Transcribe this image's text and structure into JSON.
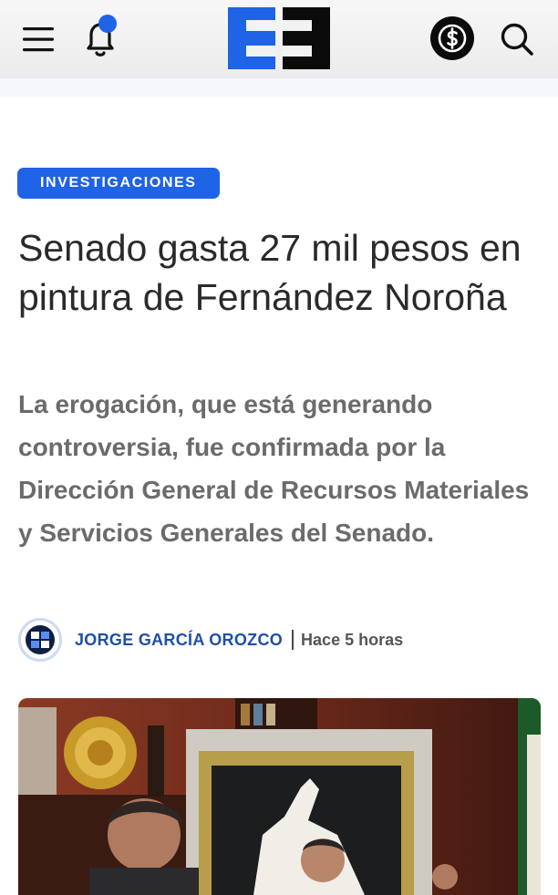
{
  "header": {
    "logo_alt": "EE",
    "icons": [
      "menu-icon",
      "bell-icon",
      "dollar-coin-icon",
      "search-icon"
    ],
    "accent_color": "#1f63e6"
  },
  "article": {
    "category": "INVESTIGACIONES",
    "headline": "Senado gasta 27 mil pesos en pintura de Fernández Noroña",
    "dek": "La erogación, que está generando controversia, fue confirmada por la Dirección General de Recursos Materiales y Servicios Generales del Senado.",
    "author": "JORGE GARCÍA OROZCO",
    "time": "Hace 5 horas"
  }
}
